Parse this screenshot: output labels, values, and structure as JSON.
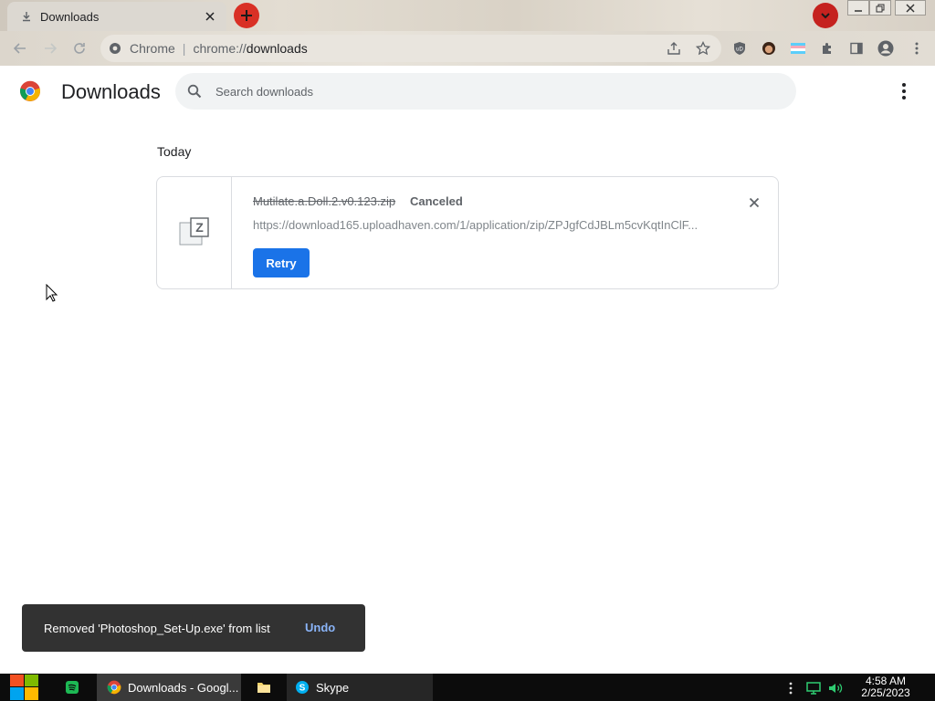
{
  "browser": {
    "tab": {
      "title": "Downloads"
    },
    "omnibox": {
      "site_name": "Chrome",
      "url_prefix": "chrome://",
      "url_host": "downloads"
    }
  },
  "page": {
    "title": "Downloads",
    "search": {
      "placeholder": "Search downloads",
      "value": ""
    }
  },
  "downloads": {
    "section_label": "Today",
    "items": [
      {
        "filename": "Mutilate.a.Doll.2.v0.123.zip",
        "status": "Canceled",
        "url": "https://download165.uploadhaven.com/1/application/zip/ZPJgfCdJBLm5cvKqtInClF...",
        "action_label": "Retry"
      }
    ]
  },
  "toast": {
    "message": "Removed 'Photoshop_Set-Up.exe' from list",
    "action_label": "Undo"
  },
  "taskbar": {
    "apps": [
      {
        "label": "Downloads - Googl..."
      },
      {
        "label": "Skype"
      }
    ],
    "clock": {
      "time": "4:58 AM",
      "date": "2/25/2023"
    }
  },
  "colors": {
    "accent": "#1a73e8",
    "toast_bg": "#323232",
    "toast_action": "#8ab4f8",
    "new_tab_button": "#d93025"
  }
}
